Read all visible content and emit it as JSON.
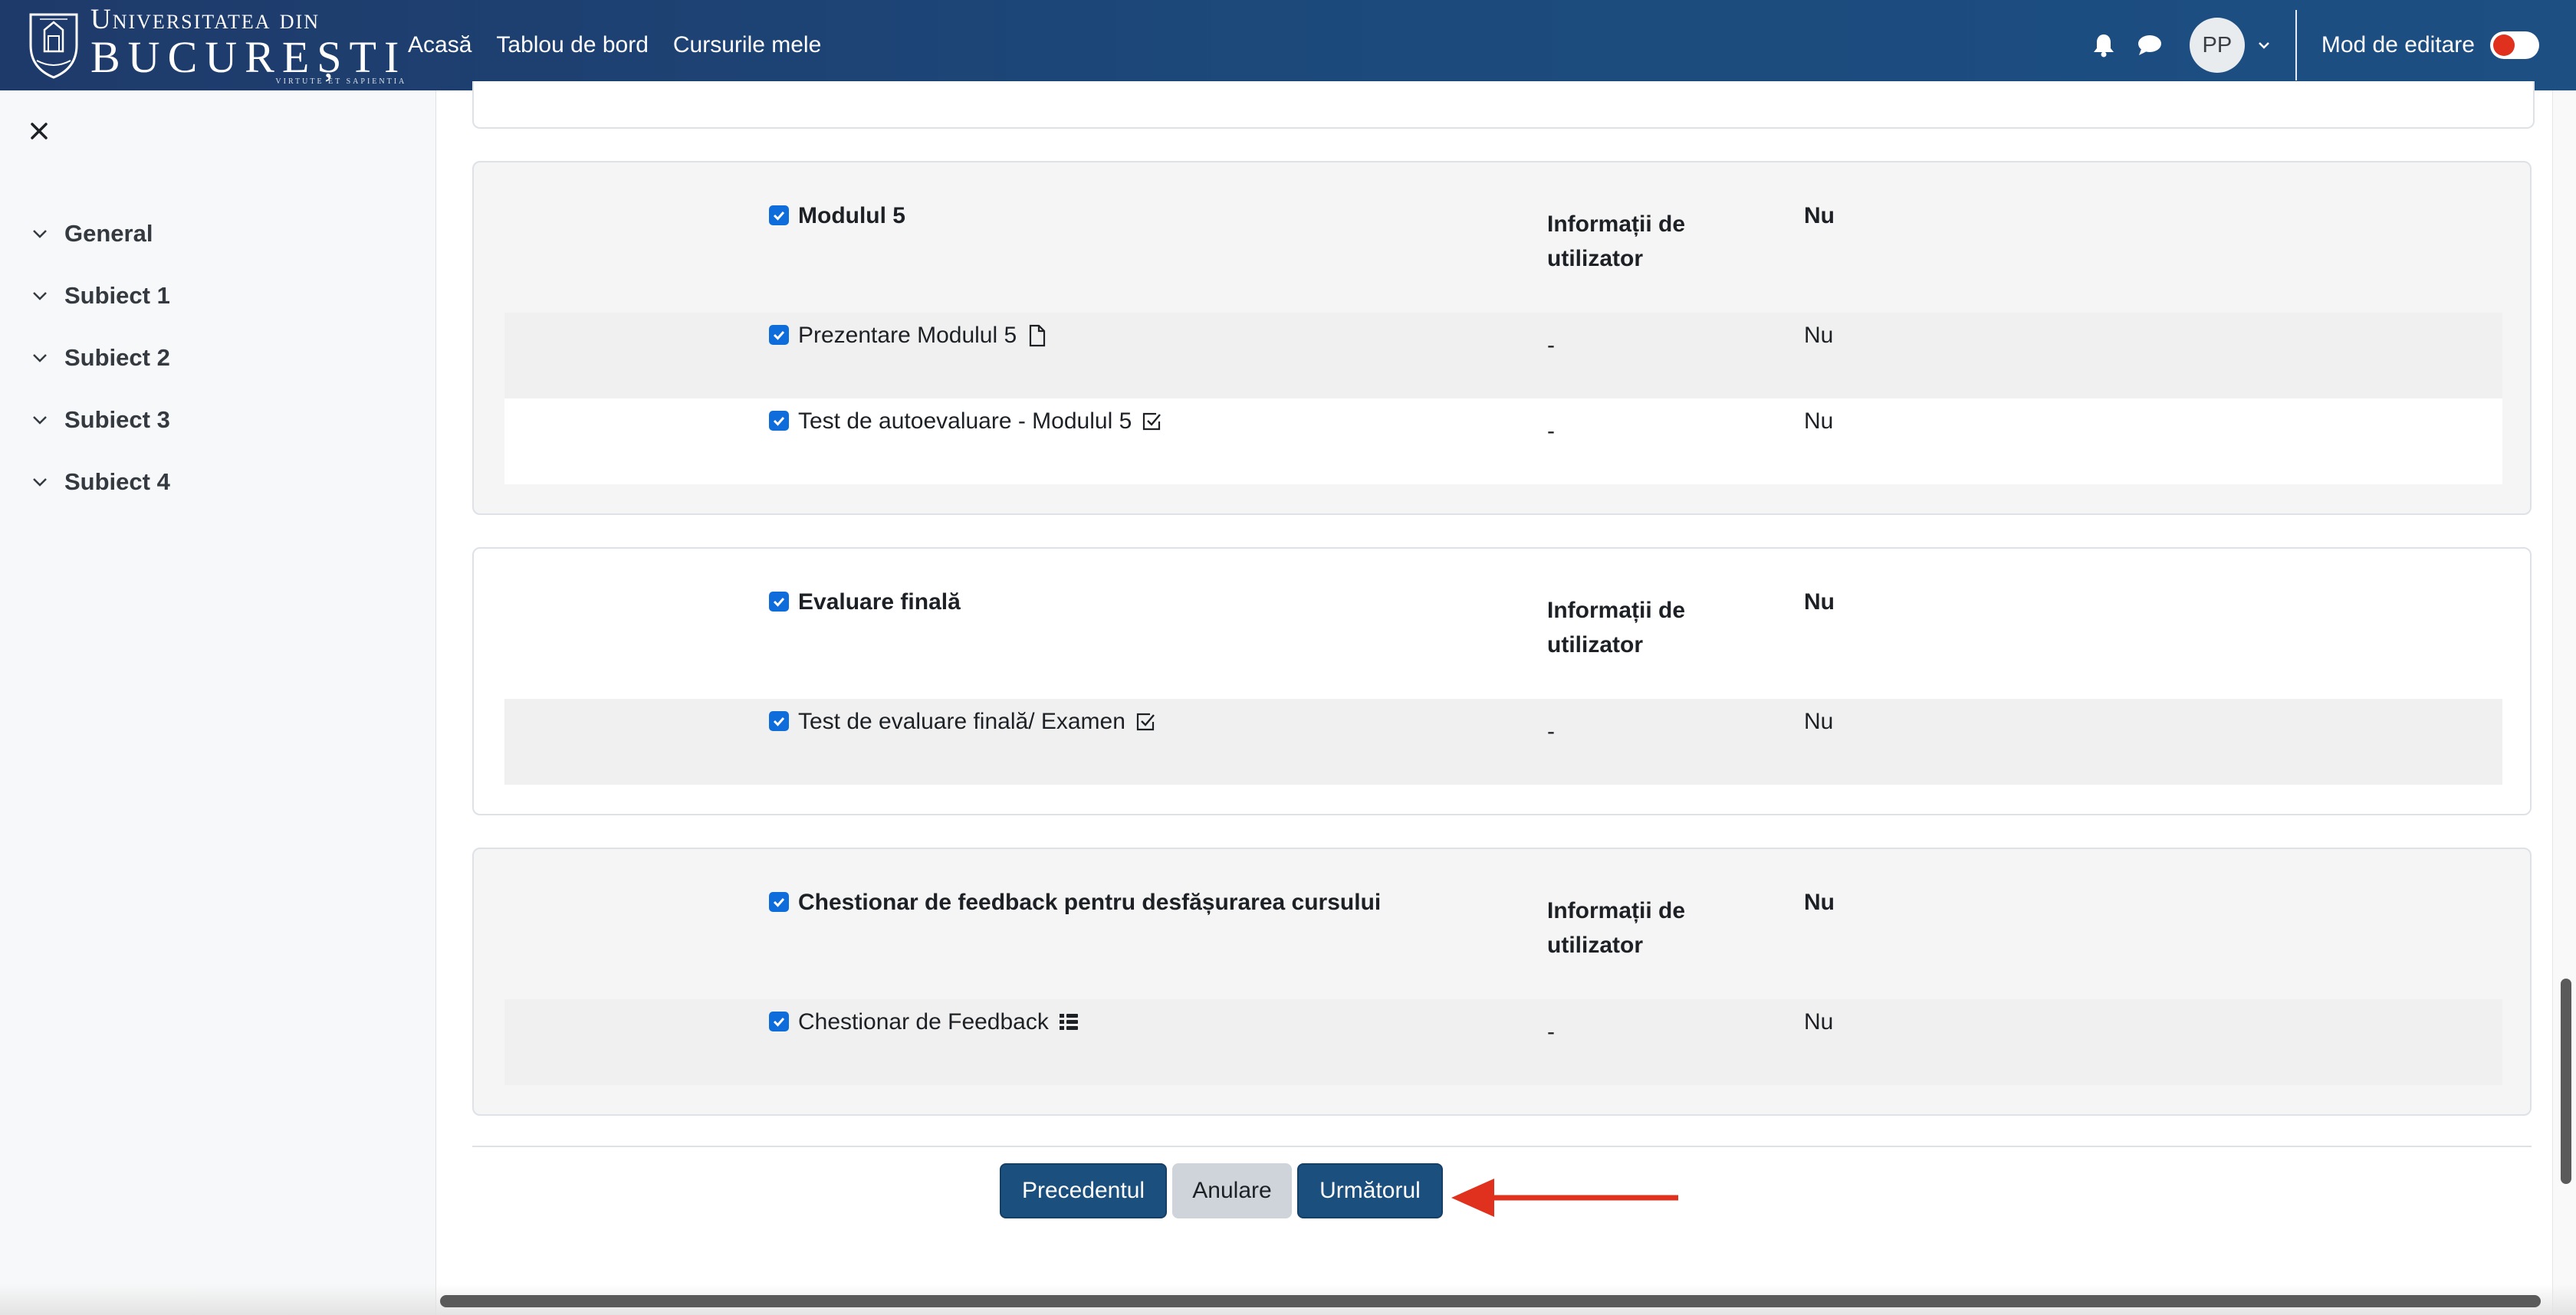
{
  "brand": {
    "line1": "Universitatea din",
    "line2": "BUCUREȘTI",
    "motto": "VIRTUTE ET SAPIENTIA"
  },
  "nav": {
    "links": [
      "Acasă",
      "Tablou de bord",
      "Cursurile mele"
    ],
    "icons": [
      "bell-icon",
      "chat-icon"
    ],
    "avatar_initials": "PP",
    "edit_mode_label": "Mod de editare",
    "edit_mode_on": false
  },
  "sidebar": {
    "close_icon": "close-icon",
    "items": [
      {
        "label": "General"
      },
      {
        "label": "Subiect 1"
      },
      {
        "label": "Subiect 2"
      },
      {
        "label": "Subiect 3"
      },
      {
        "label": "Subiect 4"
      }
    ]
  },
  "sections": [
    {
      "title": "Modulul 5",
      "col2": "Informații de utilizator",
      "col3": "Nu",
      "activities": [
        {
          "name": "Prezentare Modulul 5",
          "icon": "file-icon",
          "col2": "-",
          "col3": "Nu"
        },
        {
          "name": "Test de autoevaluare - Modulul 5",
          "icon": "quiz-icon",
          "col2": "-",
          "col3": "Nu"
        }
      ]
    },
    {
      "title": "Evaluare finală",
      "col2": "Informații de utilizator",
      "col3": "Nu",
      "activities": [
        {
          "name": "Test de evaluare finală/ Examen",
          "icon": "quiz-icon",
          "col2": "-",
          "col3": "Nu"
        }
      ]
    },
    {
      "title": "Chestionar de feedback pentru desfășurarea cursului",
      "col2": "Informații de utilizator",
      "col3": "Nu",
      "activities": [
        {
          "name": "Chestionar de Feedback",
          "icon": "feedback-icon",
          "col2": "-",
          "col3": "Nu"
        }
      ]
    }
  ],
  "buttons": {
    "previous": "Precedentul",
    "cancel": "Anulare",
    "next": "Următorul"
  },
  "colors": {
    "navbar": "#1e3a6a",
    "primary_button": "#1b4f7e",
    "checkbox": "#0f6cdb",
    "annotation_arrow": "#e0301e"
  }
}
